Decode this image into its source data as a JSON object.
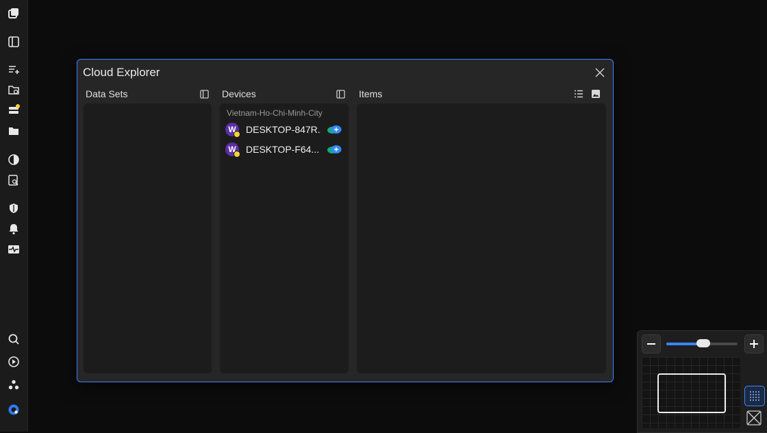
{
  "window": {
    "title": "Cloud Explorer"
  },
  "panes": {
    "datasets": {
      "header": "Data Sets"
    },
    "devices": {
      "header": "Devices",
      "region": "Vietnam-Ho-Chi-Minh-City",
      "items": [
        {
          "avatar_letter": "W",
          "name": "DESKTOP-847R..."
        },
        {
          "avatar_letter": "W",
          "name": "DESKTOP-F64..."
        }
      ]
    },
    "items": {
      "header": "Items"
    }
  },
  "rail": {
    "icons": [
      "windows-icon",
      "sidebar-panel-icon",
      "add-list-icon",
      "cloud-folder-icon",
      "storage-icon",
      "folder-icon",
      "pie-chart-icon",
      "search-document-icon",
      "shield-icon",
      "bell-icon",
      "activity-monitor-icon",
      "search-icon",
      "play-circle-icon",
      "group-icon",
      "app-logo-icon"
    ]
  },
  "navigator": {
    "zoom_level": 0.52
  },
  "colors": {
    "accent": "#3a86ff",
    "status_dot": "#f5d43a",
    "avatar": "#5b2fa6"
  }
}
